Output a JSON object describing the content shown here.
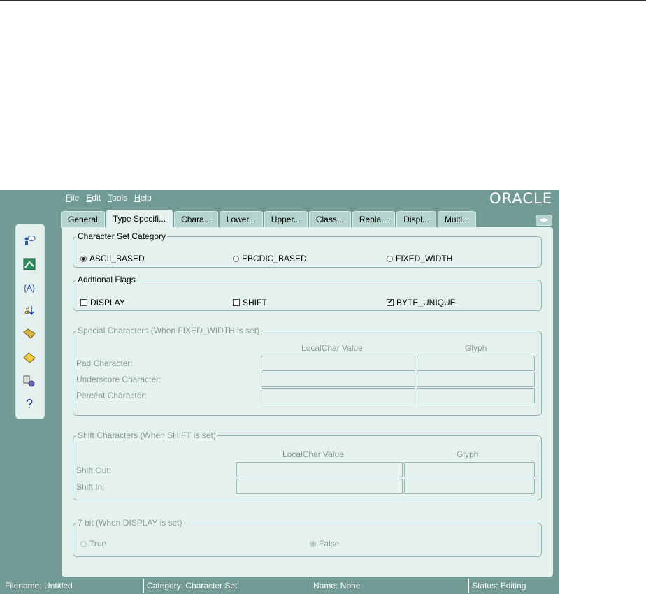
{
  "app": {
    "logo": "ORACLE",
    "menu": [
      {
        "key": "F",
        "rest": "ile"
      },
      {
        "key": "E",
        "rest": "dit"
      },
      {
        "key": "T",
        "rest": "ools"
      },
      {
        "key": "H",
        "rest": "elp"
      }
    ]
  },
  "tabs": [
    "General",
    "Type Specifi...",
    "Chara...",
    "Lower...",
    "Upper...",
    "Class...",
    "Repla...",
    "Displ...",
    "Multi..."
  ],
  "active_tab": "Type Specifi...",
  "toolbar_icons": [
    "user-help-icon",
    "map-icon",
    "variable-icon",
    "sort-icon",
    "open-folder-icon",
    "edit-note-icon",
    "settings-icon",
    "help-icon"
  ],
  "charset_category": {
    "legend": "Character Set Category",
    "options": [
      "ASCII_BASED",
      "EBCDIC_BASED",
      "FIXED_WIDTH"
    ],
    "selected": "ASCII_BASED"
  },
  "additional_flags": {
    "legend": "Addtional Flags",
    "display": {
      "label": "DISPLAY",
      "checked": false
    },
    "shift": {
      "label": "SHIFT",
      "checked": false
    },
    "byte_unique": {
      "label": "BYTE_UNIQUE",
      "checked": true
    }
  },
  "special_chars": {
    "legend": "Special Characters (When FIXED_WIDTH is set)",
    "col_localchar": "LocalChar Value",
    "col_glyph": "Glyph",
    "rows": [
      "Pad Character:",
      "Underscore Character:",
      "Percent Character:"
    ]
  },
  "shift_chars": {
    "legend": "Shift Characters (When SHIFT is set)",
    "col_localchar": "LocalChar Value",
    "col_glyph": "Glyph",
    "rows": [
      "Shift Out:",
      "Shift In:"
    ]
  },
  "seven_bit": {
    "legend": "7 bit (When DISPLAY is set)",
    "true_label": "True",
    "false_label": "False",
    "selected": "False"
  },
  "status": {
    "filename": "Filename: Untitled",
    "category": "Category: Character Set",
    "name": "Name: None",
    "state": "Status: Editing"
  },
  "colors": {
    "frame": "#739b95",
    "panel": "#e4f1ee",
    "tab": "#b4d3cc"
  }
}
